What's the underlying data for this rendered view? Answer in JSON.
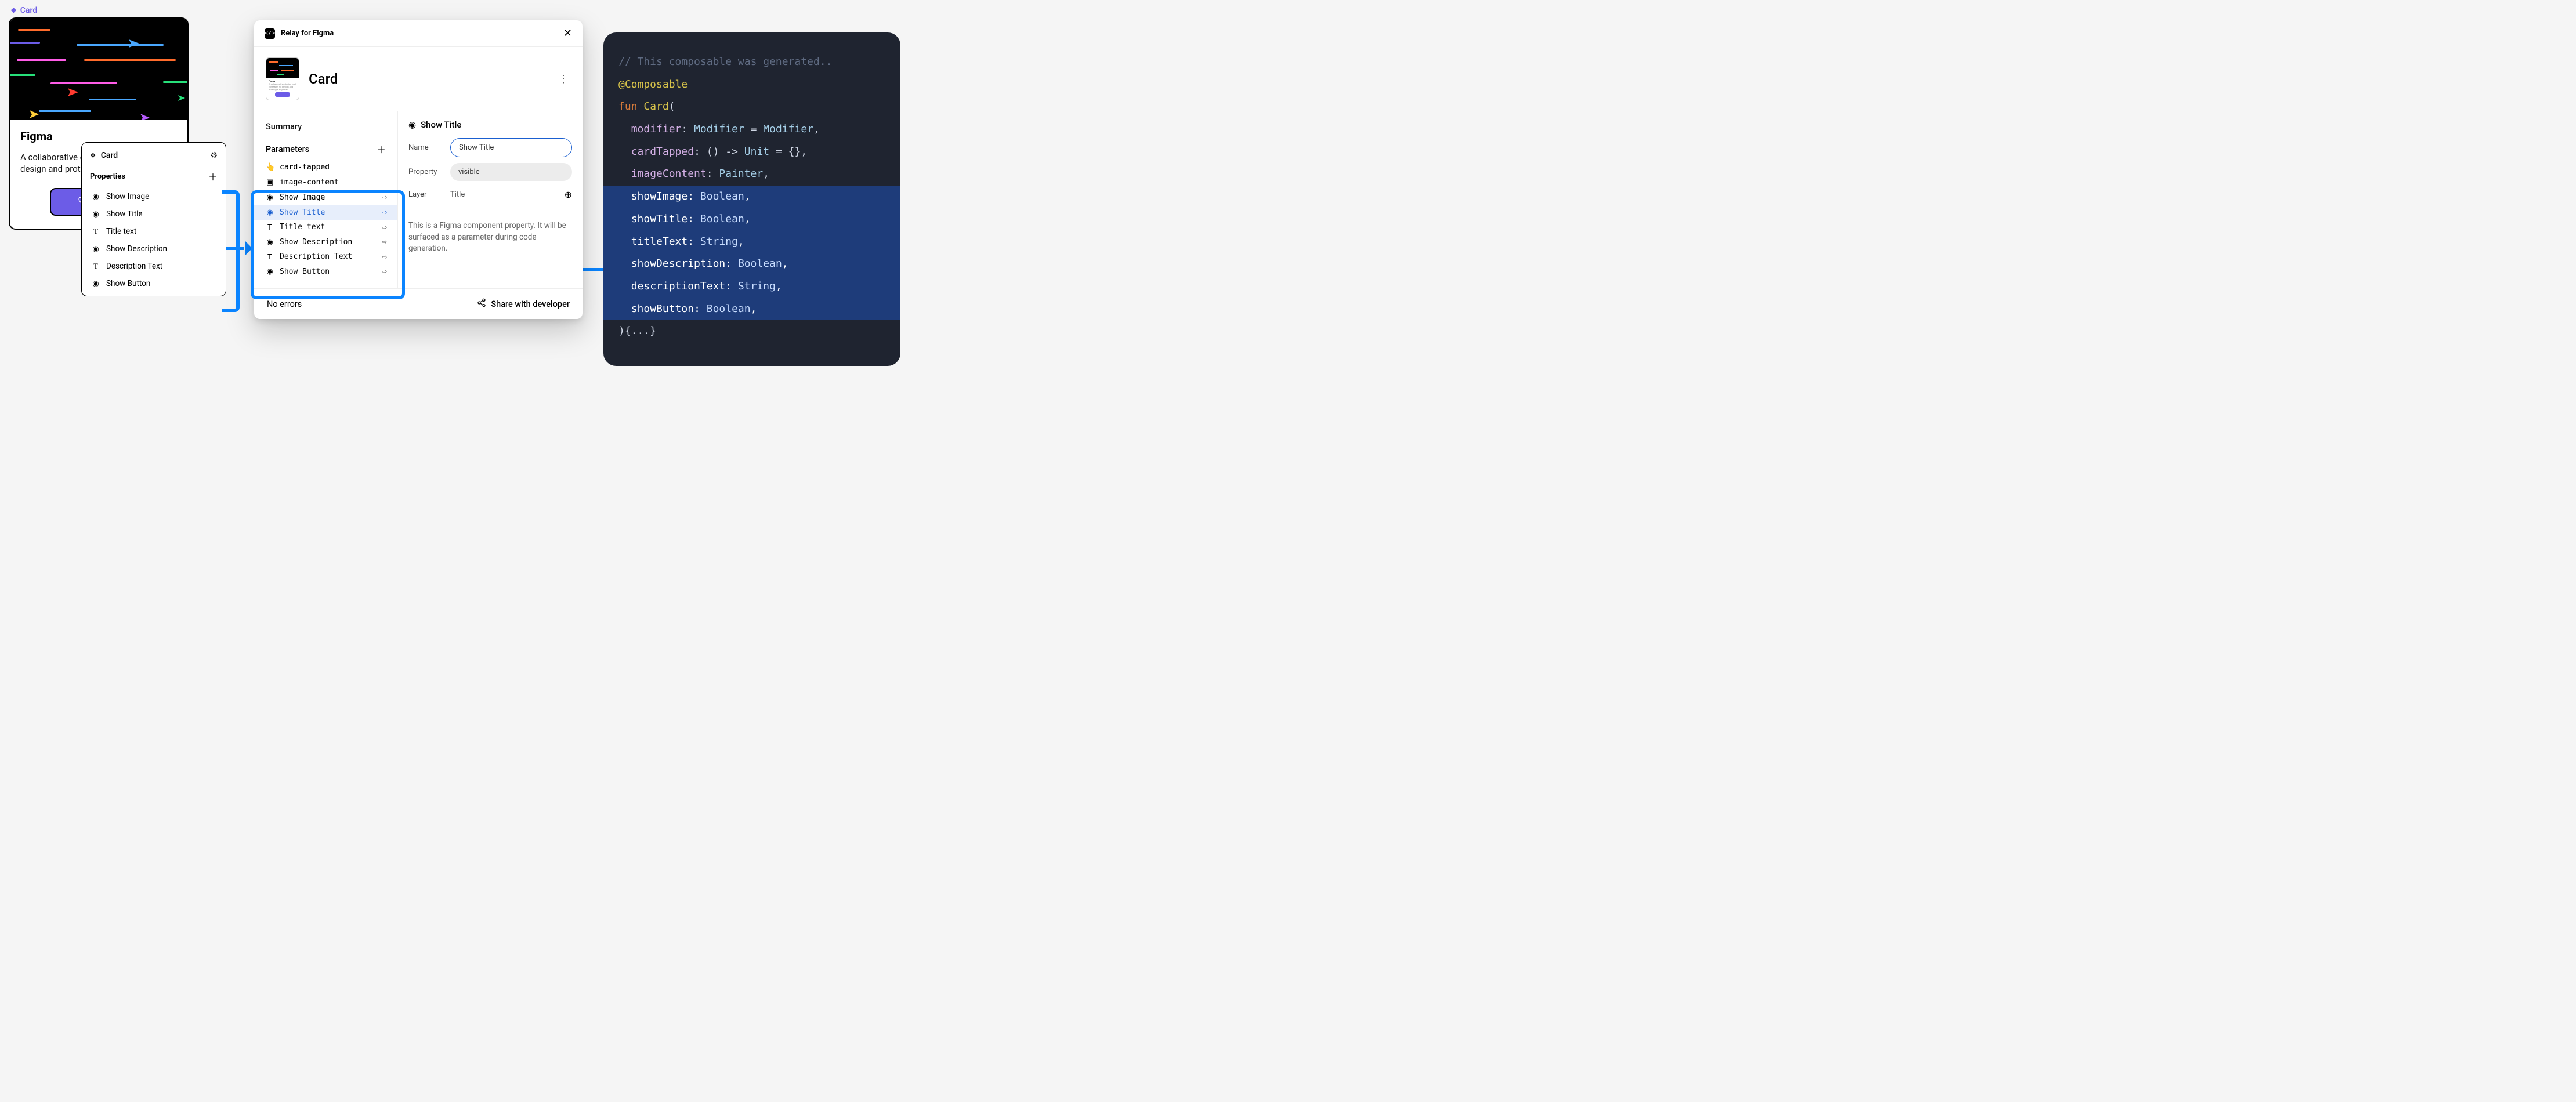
{
  "component_label": "Card",
  "card": {
    "title": "Figma",
    "description": "A collaborative design tool for teams to design and prototype together.",
    "button_label": "Button"
  },
  "props_panel": {
    "title": "Card",
    "section": "Properties",
    "items": [
      {
        "icon": "eye",
        "label": "Show Image"
      },
      {
        "icon": "eye",
        "label": "Show Title"
      },
      {
        "icon": "text",
        "label": "Title text"
      },
      {
        "icon": "eye",
        "label": "Show Description"
      },
      {
        "icon": "text",
        "label": "Description Text"
      },
      {
        "icon": "eye",
        "label": "Show Button"
      }
    ]
  },
  "relay": {
    "app_name": "Relay for Figma",
    "card_title": "Card",
    "summary_h": "Summary",
    "parameters_h": "Parameters",
    "params": [
      {
        "icon": "tap",
        "label": "card-tapped",
        "swap": false
      },
      {
        "icon": "img",
        "label": "image-content",
        "swap": false
      },
      {
        "icon": "eye",
        "label": "Show Image",
        "swap": true
      },
      {
        "icon": "eye",
        "label": "Show Title",
        "swap": true,
        "selected": true
      },
      {
        "icon": "text",
        "label": "Title text",
        "swap": true
      },
      {
        "icon": "eye",
        "label": "Show Description",
        "swap": true
      },
      {
        "icon": "text",
        "label": "Description Text",
        "swap": true
      },
      {
        "icon": "eye",
        "label": "Show Button",
        "swap": true
      }
    ],
    "right": {
      "header": "Show Title",
      "name_label": "Name",
      "name_value": "Show Title",
      "property_label": "Property",
      "property_value": "visible",
      "layer_label": "Layer",
      "layer_value": "Title",
      "description": "This is a Figma component property. It will be surfaced as a parameter during code generation."
    },
    "footer": {
      "errors": "No errors",
      "share": "Share with developer"
    }
  },
  "code": {
    "comment": "// This composable was generated..",
    "annotation": "@Composable",
    "fun_kw": "fun",
    "fn_name": "Card",
    "lines": [
      "  modifier: Modifier = Modifier,",
      "  cardTapped: () -> Unit = {},",
      "  imageContent: Painter,"
    ],
    "hl_lines": [
      "  showImage: Boolean,",
      "  showTitle: Boolean,",
      "  titleText: String,",
      "  showDescription: Boolean,",
      "  descriptionText: String,",
      "  showButton: Boolean,"
    ],
    "tail": "){...}"
  }
}
